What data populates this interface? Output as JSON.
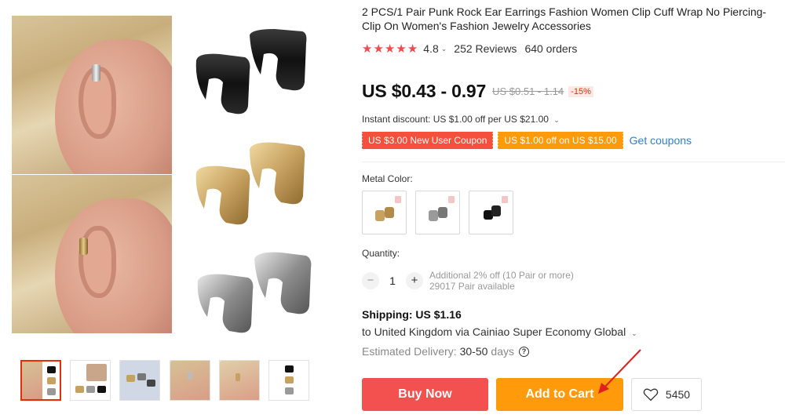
{
  "product": {
    "title": "2 PCS/1 Pair Punk Rock Ear Earrings Fashion Women Clip Cuff Wrap No Piercing-Clip On Women's Fashion Jewelry Accessories",
    "rating": "4.8",
    "reviews": "252 Reviews",
    "orders": "640 orders",
    "price": "US $0.43 - 0.97",
    "original_price": "US $0.51 - 1.14",
    "discount": "-15%",
    "instant_discount": "Instant discount: US $1.00 off per US $21.00",
    "coupons": [
      {
        "label": "US $3.00 New User Coupon",
        "color": "#f5503b"
      },
      {
        "label": "US $1.00 off on US $15.00",
        "color": "#ff9a0a"
      }
    ],
    "get_coupons": "Get coupons",
    "metal_color_label": "Metal Color:",
    "swatches": [
      "gold",
      "silver",
      "black"
    ],
    "quantity_label": "Quantity:",
    "quantity": "1",
    "quantity_note_1": "Additional 2% off (10 Pair or more)",
    "quantity_note_2": "29017 Pair available",
    "shipping": "Shipping: US $1.16",
    "shipping_dest": "to United Kingdom via Cainiao Super Economy Global",
    "delivery_label": "Estimated Delivery:",
    "delivery_value": "30-50",
    "delivery_unit": "days",
    "buy_now": "Buy Now",
    "add_to_cart": "Add to Cart",
    "wishlist_count": "5450"
  },
  "colors": {
    "accent_red": "#f35050",
    "accent_orange": "#ff9a0a",
    "link_blue": "#2e7fd0"
  },
  "gallery": {
    "thumb_count": 6,
    "active_thumb": 0
  }
}
